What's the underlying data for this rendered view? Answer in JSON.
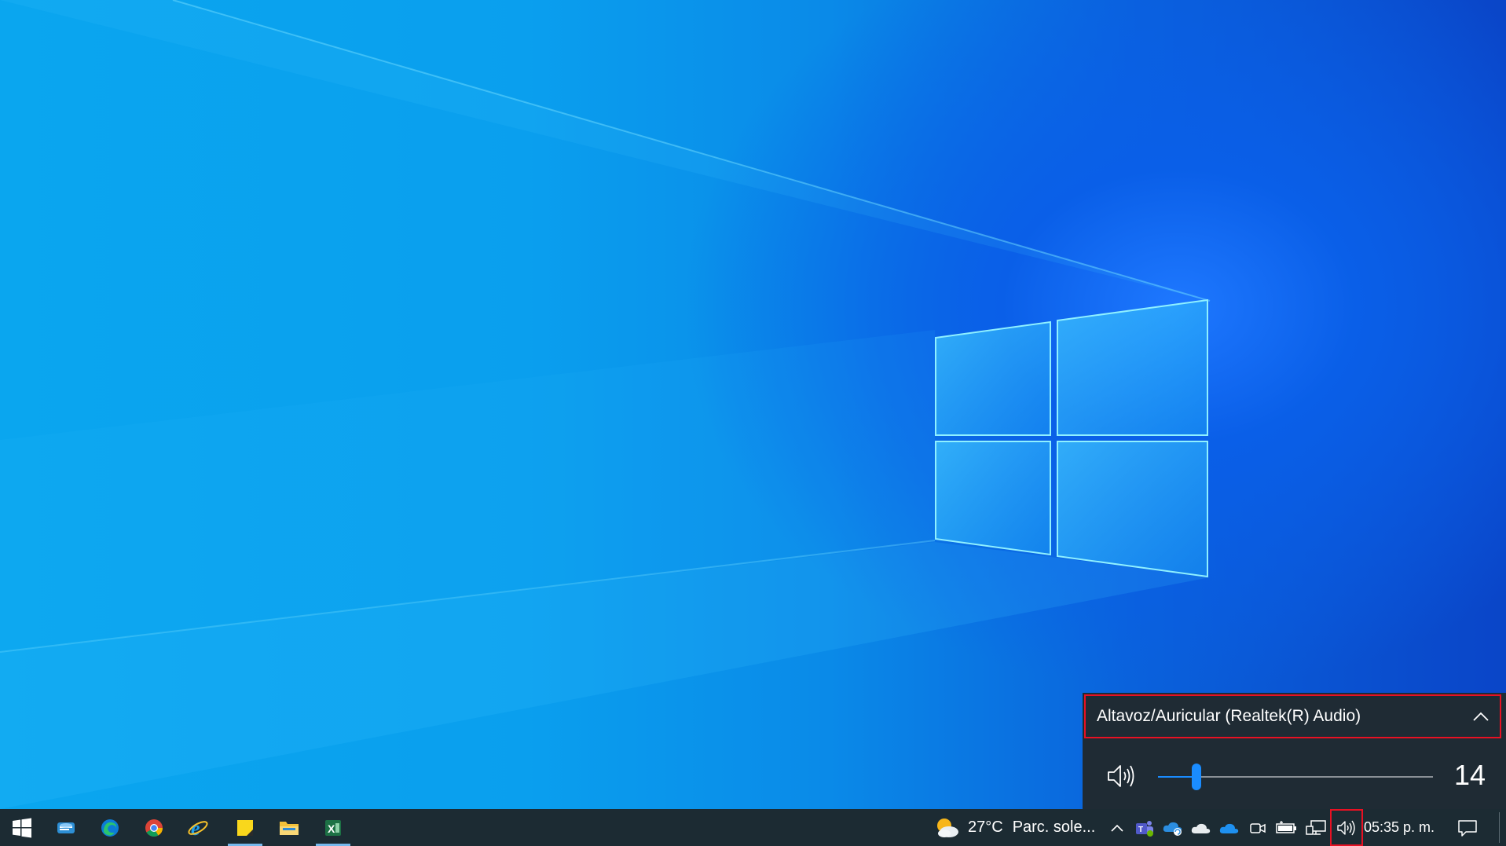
{
  "volume_flyout": {
    "device_name": "Altavoz/Auricular (Realtek(R) Audio)",
    "volume_value": "14",
    "volume_level": 14
  },
  "taskbar": {
    "pinned_apps": [
      {
        "name": "start-button",
        "icon": "windows-logo-icon"
      },
      {
        "name": "app-network",
        "icon": "network-app-icon"
      },
      {
        "name": "app-edge",
        "icon": "edge-icon"
      },
      {
        "name": "app-chrome",
        "icon": "chrome-icon"
      },
      {
        "name": "app-internet-explorer",
        "icon": "internet-explorer-icon"
      },
      {
        "name": "app-sticky-notes",
        "icon": "sticky-notes-icon"
      },
      {
        "name": "app-file-explorer",
        "icon": "folder-icon"
      },
      {
        "name": "app-excel",
        "icon": "excel-icon"
      }
    ],
    "weather": {
      "temperature": "27°C",
      "description": "Parc. sole..."
    },
    "clock": "05:35 p. m.",
    "colors": {
      "accent": "#1a8cff",
      "highlight_box": "#e81123",
      "taskbar_bg": "#1c2b33",
      "flyout_bg": "#1f2b34"
    }
  }
}
